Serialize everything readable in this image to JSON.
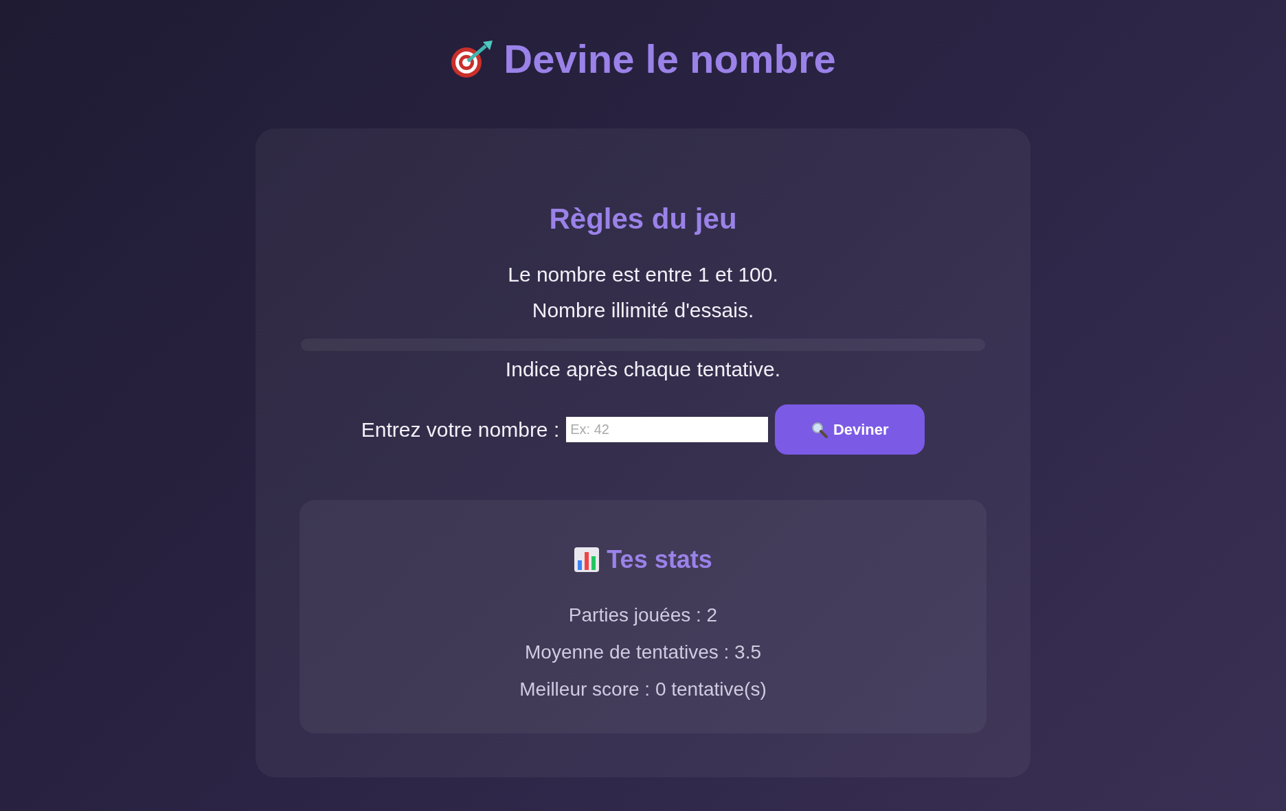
{
  "title": "Devine le nombre",
  "rules": {
    "heading": "Règles du jeu",
    "lines": [
      "Le nombre est entre 1 et 100.",
      "Nombre illimité d'essais."
    ],
    "hint": "Indice après chaque tentative."
  },
  "guess": {
    "label": "Entrez votre nombre :",
    "placeholder": "Ex: 42",
    "button": "Deviner"
  },
  "stats": {
    "heading": "Tes stats",
    "lines": [
      "Parties jouées : 2",
      "Moyenne de tentatives : 3.5",
      "Meilleur score : 0 tentative(s)"
    ]
  }
}
